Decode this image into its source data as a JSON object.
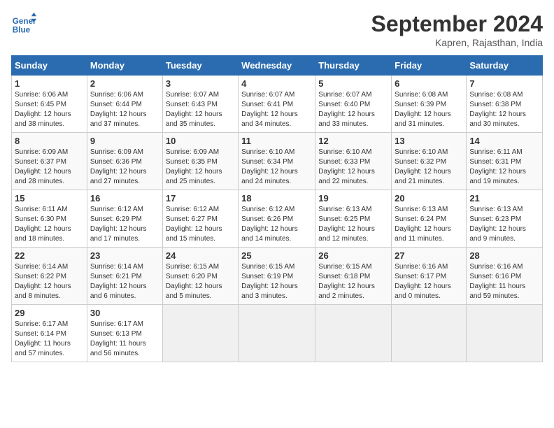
{
  "header": {
    "logo_line1": "General",
    "logo_line2": "Blue",
    "month": "September 2024",
    "location": "Kapren, Rajasthan, India"
  },
  "days_of_week": [
    "Sunday",
    "Monday",
    "Tuesday",
    "Wednesday",
    "Thursday",
    "Friday",
    "Saturday"
  ],
  "weeks": [
    [
      {
        "day": "1",
        "info": "Sunrise: 6:06 AM\nSunset: 6:45 PM\nDaylight: 12 hours\nand 38 minutes."
      },
      {
        "day": "2",
        "info": "Sunrise: 6:06 AM\nSunset: 6:44 PM\nDaylight: 12 hours\nand 37 minutes."
      },
      {
        "day": "3",
        "info": "Sunrise: 6:07 AM\nSunset: 6:43 PM\nDaylight: 12 hours\nand 35 minutes."
      },
      {
        "day": "4",
        "info": "Sunrise: 6:07 AM\nSunset: 6:41 PM\nDaylight: 12 hours\nand 34 minutes."
      },
      {
        "day": "5",
        "info": "Sunrise: 6:07 AM\nSunset: 6:40 PM\nDaylight: 12 hours\nand 33 minutes."
      },
      {
        "day": "6",
        "info": "Sunrise: 6:08 AM\nSunset: 6:39 PM\nDaylight: 12 hours\nand 31 minutes."
      },
      {
        "day": "7",
        "info": "Sunrise: 6:08 AM\nSunset: 6:38 PM\nDaylight: 12 hours\nand 30 minutes."
      }
    ],
    [
      {
        "day": "8",
        "info": "Sunrise: 6:09 AM\nSunset: 6:37 PM\nDaylight: 12 hours\nand 28 minutes."
      },
      {
        "day": "9",
        "info": "Sunrise: 6:09 AM\nSunset: 6:36 PM\nDaylight: 12 hours\nand 27 minutes."
      },
      {
        "day": "10",
        "info": "Sunrise: 6:09 AM\nSunset: 6:35 PM\nDaylight: 12 hours\nand 25 minutes."
      },
      {
        "day": "11",
        "info": "Sunrise: 6:10 AM\nSunset: 6:34 PM\nDaylight: 12 hours\nand 24 minutes."
      },
      {
        "day": "12",
        "info": "Sunrise: 6:10 AM\nSunset: 6:33 PM\nDaylight: 12 hours\nand 22 minutes."
      },
      {
        "day": "13",
        "info": "Sunrise: 6:10 AM\nSunset: 6:32 PM\nDaylight: 12 hours\nand 21 minutes."
      },
      {
        "day": "14",
        "info": "Sunrise: 6:11 AM\nSunset: 6:31 PM\nDaylight: 12 hours\nand 19 minutes."
      }
    ],
    [
      {
        "day": "15",
        "info": "Sunrise: 6:11 AM\nSunset: 6:30 PM\nDaylight: 12 hours\nand 18 minutes."
      },
      {
        "day": "16",
        "info": "Sunrise: 6:12 AM\nSunset: 6:29 PM\nDaylight: 12 hours\nand 17 minutes."
      },
      {
        "day": "17",
        "info": "Sunrise: 6:12 AM\nSunset: 6:27 PM\nDaylight: 12 hours\nand 15 minutes."
      },
      {
        "day": "18",
        "info": "Sunrise: 6:12 AM\nSunset: 6:26 PM\nDaylight: 12 hours\nand 14 minutes."
      },
      {
        "day": "19",
        "info": "Sunrise: 6:13 AM\nSunset: 6:25 PM\nDaylight: 12 hours\nand 12 minutes."
      },
      {
        "day": "20",
        "info": "Sunrise: 6:13 AM\nSunset: 6:24 PM\nDaylight: 12 hours\nand 11 minutes."
      },
      {
        "day": "21",
        "info": "Sunrise: 6:13 AM\nSunset: 6:23 PM\nDaylight: 12 hours\nand 9 minutes."
      }
    ],
    [
      {
        "day": "22",
        "info": "Sunrise: 6:14 AM\nSunset: 6:22 PM\nDaylight: 12 hours\nand 8 minutes."
      },
      {
        "day": "23",
        "info": "Sunrise: 6:14 AM\nSunset: 6:21 PM\nDaylight: 12 hours\nand 6 minutes."
      },
      {
        "day": "24",
        "info": "Sunrise: 6:15 AM\nSunset: 6:20 PM\nDaylight: 12 hours\nand 5 minutes."
      },
      {
        "day": "25",
        "info": "Sunrise: 6:15 AM\nSunset: 6:19 PM\nDaylight: 12 hours\nand 3 minutes."
      },
      {
        "day": "26",
        "info": "Sunrise: 6:15 AM\nSunset: 6:18 PM\nDaylight: 12 hours\nand 2 minutes."
      },
      {
        "day": "27",
        "info": "Sunrise: 6:16 AM\nSunset: 6:17 PM\nDaylight: 12 hours\nand 0 minutes."
      },
      {
        "day": "28",
        "info": "Sunrise: 6:16 AM\nSunset: 6:16 PM\nDaylight: 11 hours\nand 59 minutes."
      }
    ],
    [
      {
        "day": "29",
        "info": "Sunrise: 6:17 AM\nSunset: 6:14 PM\nDaylight: 11 hours\nand 57 minutes."
      },
      {
        "day": "30",
        "info": "Sunrise: 6:17 AM\nSunset: 6:13 PM\nDaylight: 11 hours\nand 56 minutes."
      },
      {
        "day": "",
        "info": ""
      },
      {
        "day": "",
        "info": ""
      },
      {
        "day": "",
        "info": ""
      },
      {
        "day": "",
        "info": ""
      },
      {
        "day": "",
        "info": ""
      }
    ]
  ]
}
